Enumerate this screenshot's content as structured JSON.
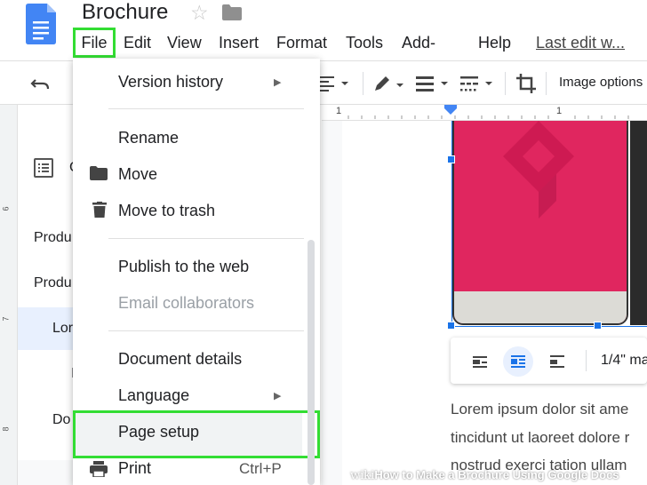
{
  "header": {
    "title": "Brochure"
  },
  "menubar": {
    "file": "File",
    "edit": "Edit",
    "view": "View",
    "insert": "Insert",
    "format": "Format",
    "tools": "Tools",
    "addons": "Add-ons",
    "help": "Help",
    "last_edit": "Last edit w..."
  },
  "toolbar": {
    "image_options": "Image options"
  },
  "outline": {
    "items": [
      "C",
      "Produ",
      "Produ",
      "Lor",
      "I",
      "Do"
    ]
  },
  "ruler": {
    "h_ticks": [
      "1",
      "1"
    ],
    "v_ticks": [
      "6",
      "7",
      "8"
    ]
  },
  "file_menu": {
    "version_history": "Version history",
    "rename": "Rename",
    "move": "Move",
    "move_to_trash": "Move to trash",
    "publish": "Publish to the web",
    "email_collaborators": "Email collaborators",
    "document_details": "Document details",
    "language": "Language",
    "page_setup": "Page setup",
    "print": "Print",
    "print_shortcut": "Ctrl+P"
  },
  "image_toolbar": {
    "margin": "1/4\" ma"
  },
  "document": {
    "lines": [
      "Lorem ipsum dolor sit ame",
      "tincidunt ut laoreet dolore r",
      "nostrud exerci tation ullam"
    ]
  },
  "watermark": {
    "prefix": "wiki",
    "text": "How to Make a Brochure Using Google Docs"
  },
  "colors": {
    "highlight": "#33dd33",
    "doc_blue": "#4285f4",
    "image_pink": "#e0265f"
  }
}
